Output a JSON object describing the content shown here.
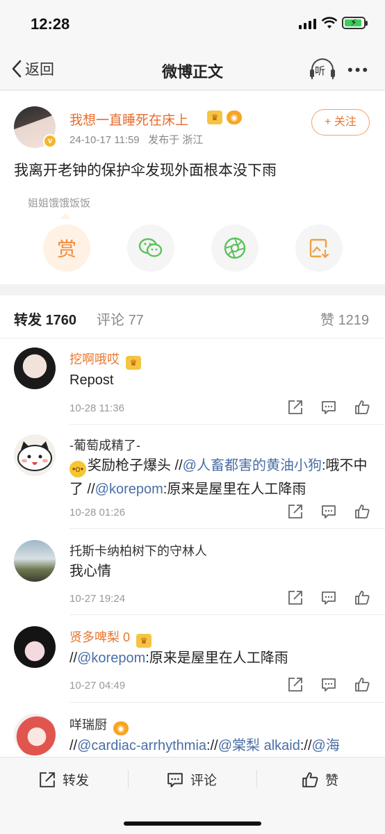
{
  "status": {
    "time": "12:28"
  },
  "nav": {
    "back_label": "返回",
    "title": "微博正文",
    "listen_label": "听"
  },
  "post": {
    "author": "我想一直睡死在床上",
    "timestamp": "24-10-17 11:59",
    "location": "发布于 浙江",
    "follow_label": "+ 关注",
    "text": "我离开老钟的保护伞发现外面根本没下雨",
    "reward_tag": "姐姐饿饿饭饭",
    "reward_label": "赏"
  },
  "tabs": {
    "repost_label": "转发",
    "repost_count": "1760",
    "comment_label": "评论",
    "comment_count": "77",
    "like_label": "赞",
    "like_count": "1219"
  },
  "reposts": [
    {
      "name": "挖啊哦哎",
      "text": "Repost",
      "time": "10-28 11:36"
    },
    {
      "name": "-葡萄成精了-",
      "emoji": "😮",
      "text_a": "奖励枪子爆头 //",
      "mention_a": "@人畜都害的黄油小狗",
      "text_b": ":哦不中了 //",
      "mention_b": "@korepom",
      "text_c": ":原来是屋里在人工降雨",
      "time": "10-28 01:26"
    },
    {
      "name": "托斯卡纳柏树下的守林人",
      "text": "我心情",
      "time": "10-27 19:24"
    },
    {
      "name": "贤多啤梨 0",
      "text_a": "//",
      "mention_a": "@korepom",
      "text_b": ":原来是屋里在人工降雨",
      "time": "10-27 04:49"
    },
    {
      "name": "咩瑞厨",
      "text_a": "//",
      "mention_a": "@cardiac-arrhythmia",
      "text_b": "://",
      "mention_b": "@棠梨 alkaid",
      "text_c": "://",
      "mention_c": "@海"
    }
  ],
  "bottom": {
    "repost": "转发",
    "comment": "评论",
    "like": "赞"
  },
  "colors": {
    "accent_orange": "#e8772e",
    "mention_blue": "#4a6ea5",
    "wechat_green": "#5cc25c"
  }
}
